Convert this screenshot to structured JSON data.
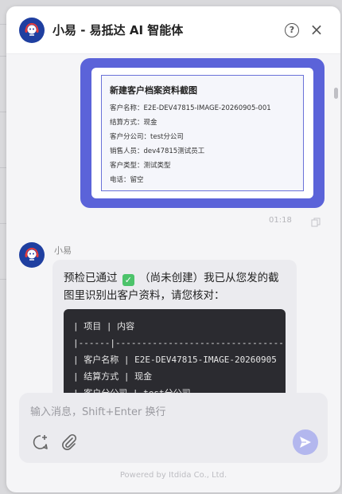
{
  "header": {
    "title": "小易 - 易抵达 AI 智能体",
    "help_label": "?",
    "close_label": "×"
  },
  "user_message": {
    "doc_title": "新建客户档案资料截图",
    "doc_lines": [
      "客户名称：E2E-DEV47815-IMAGE-20260905-001",
      "结算方式：现金",
      "客户分公司：test分公司",
      "销售人员：dev47815测试员工",
      "客户类型：测试类型",
      "电话：留空"
    ],
    "time": "01:18"
  },
  "bot_message": {
    "name": "小易",
    "text_before": "预检已通过",
    "check": "✓",
    "text_after": "（尚未创建）我已从您发的截图里识别出客户资料，请您核对：",
    "code_lines": [
      "| 项目     | 内容",
      "|------|--------------------------------",
      "| 客户名称 | E2E-DEV47815-IMAGE-20260905",
      "| 结算方式 | 现金",
      "| 客户分公司 | test分公司"
    ]
  },
  "composer": {
    "placeholder": "输入消息，Shift+Enter 换行",
    "value": ""
  },
  "footer": {
    "text": "Powered by Itdida Co., Ltd."
  },
  "colors": {
    "accent": "#5b63d9",
    "logo": "#1f3fa0",
    "send": "#b3b7ee",
    "check": "#4cc36a"
  },
  "icons": {
    "logo": "headset-robot-icon",
    "help": "question-circle-icon",
    "close": "close-icon",
    "copy": "copy-icon",
    "new_chat": "new-chat-icon",
    "attach": "paperclip-icon",
    "send": "send-icon"
  }
}
